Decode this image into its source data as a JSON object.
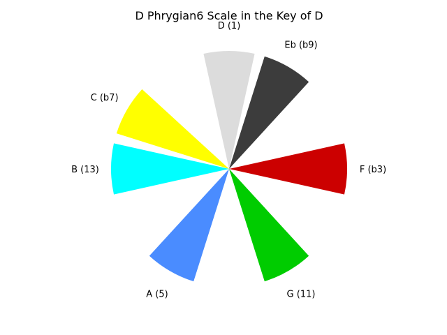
{
  "chart_data": {
    "type": "pie",
    "title": "D Phrygian6 Scale in the Key of D",
    "slices": [
      {
        "label": "D (1)",
        "value": 1,
        "color": "#dcdcdc",
        "center_angle_deg": 90
      },
      {
        "label": "Eb (b9)",
        "value": 1,
        "color": "#3c3c3c",
        "center_angle_deg": 60
      },
      {
        "label": "F (b3)",
        "value": 1,
        "color": "#cc0000",
        "center_angle_deg": 0
      },
      {
        "label": "G (11)",
        "value": 1,
        "color": "#00cc00",
        "center_angle_deg": -60
      },
      {
        "label": "A (5)",
        "value": 1,
        "color": "#4a8cff",
        "center_angle_deg": -120
      },
      {
        "label": "B (13)",
        "value": 1,
        "color": "#00ffff",
        "center_angle_deg": 180
      },
      {
        "label": "C (b7)",
        "value": 1,
        "color": "#ffff00",
        "center_angle_deg": 150
      }
    ],
    "slice_width_deg": 25,
    "legend": "none"
  }
}
